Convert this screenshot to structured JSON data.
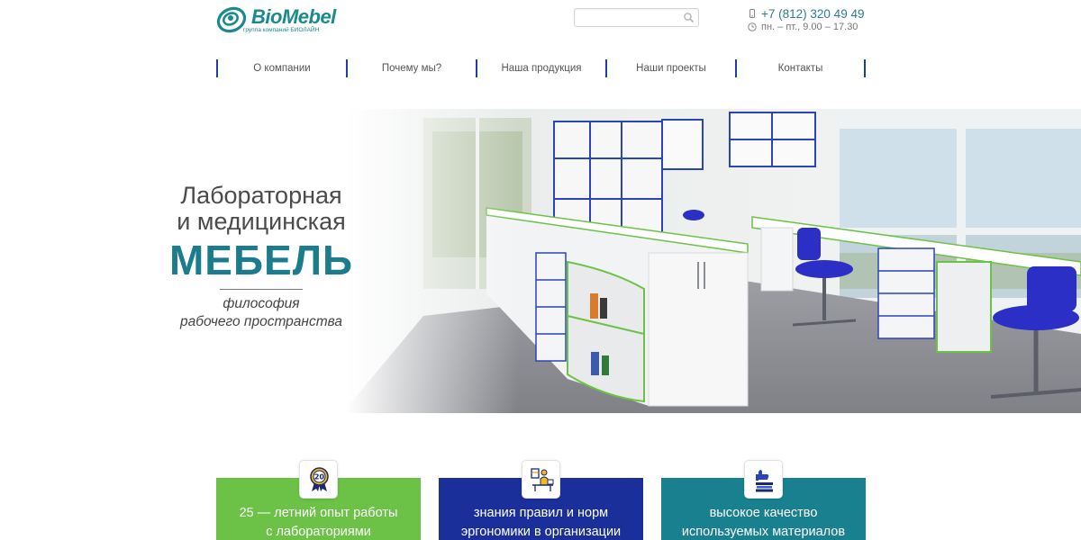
{
  "header": {
    "logo_text": "BioMebel",
    "logo_tagline": "группа компаний БИОЛАЙН",
    "search_placeholder": "",
    "phone": "+7 (812) 320 49 49",
    "hours": "пн. – пт., 9.00 – 17.30"
  },
  "nav": {
    "items": [
      {
        "label": "О компании"
      },
      {
        "label": "Почему мы?"
      },
      {
        "label": "Наша продукция"
      },
      {
        "label": "Наши проекты"
      },
      {
        "label": "Контакты"
      }
    ]
  },
  "hero": {
    "line1": "Лабораторная",
    "line2": "и медицинская",
    "title": "МЕБЕЛЬ",
    "sub1": "философия",
    "sub2": "рабочего пространства"
  },
  "features": [
    {
      "icon": "medal-20-icon",
      "line1": "25 — летний опыт работы",
      "line2": "с лабораториями",
      "color": "#6cc246"
    },
    {
      "icon": "workspace-ergonomics-icon",
      "line1": "знания правил и норм",
      "line2": "эргономики в организации",
      "color": "#1b2f9a"
    },
    {
      "icon": "quality-stack-icon",
      "line1": "высокое качество",
      "line2": "используемых материалов",
      "color": "#18808f"
    }
  ],
  "colors": {
    "brand_teal": "#1b8a8f",
    "nav_separator": "#1f3fa7",
    "green": "#6cc246",
    "blue": "#1b2f9a",
    "teal": "#18808f"
  }
}
